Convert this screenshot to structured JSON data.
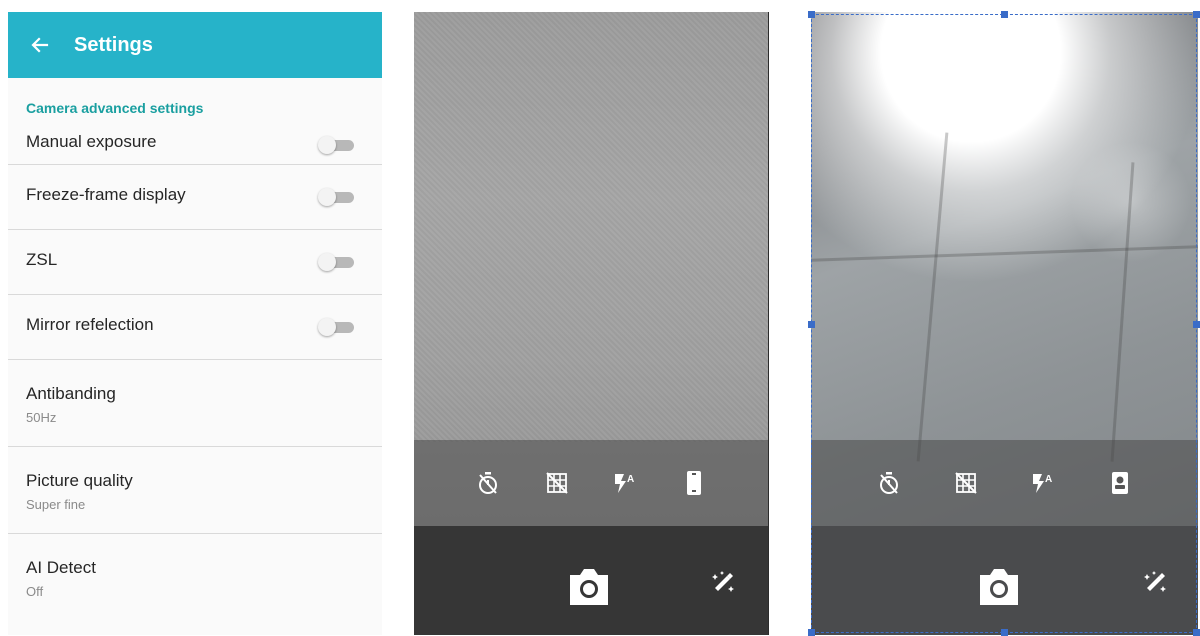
{
  "settings": {
    "title": "Settings",
    "section": "Camera advanced settings",
    "toggles": [
      {
        "label": "Manual exposure",
        "on": false
      },
      {
        "label": "Freeze-frame display",
        "on": false
      },
      {
        "label": "ZSL",
        "on": false
      },
      {
        "label": "Mirror refelection",
        "on": false
      }
    ],
    "options": [
      {
        "label": "Antibanding",
        "value": "50Hz"
      },
      {
        "label": "Picture quality",
        "value": "Super fine"
      },
      {
        "label": "AI Detect",
        "value": "Off"
      }
    ]
  },
  "camera_toolbar_icons": [
    "timer-off-icon",
    "grid-off-icon",
    "flash-auto-icon",
    "camera-switch-icon"
  ],
  "camera_bottom_icons": [
    "shutter-camera-icon",
    "magic-wand-icon"
  ],
  "colors": {
    "app_bar": "#26b3c9",
    "section_header": "#1a9fa0",
    "selection": "#3a6cc8"
  }
}
